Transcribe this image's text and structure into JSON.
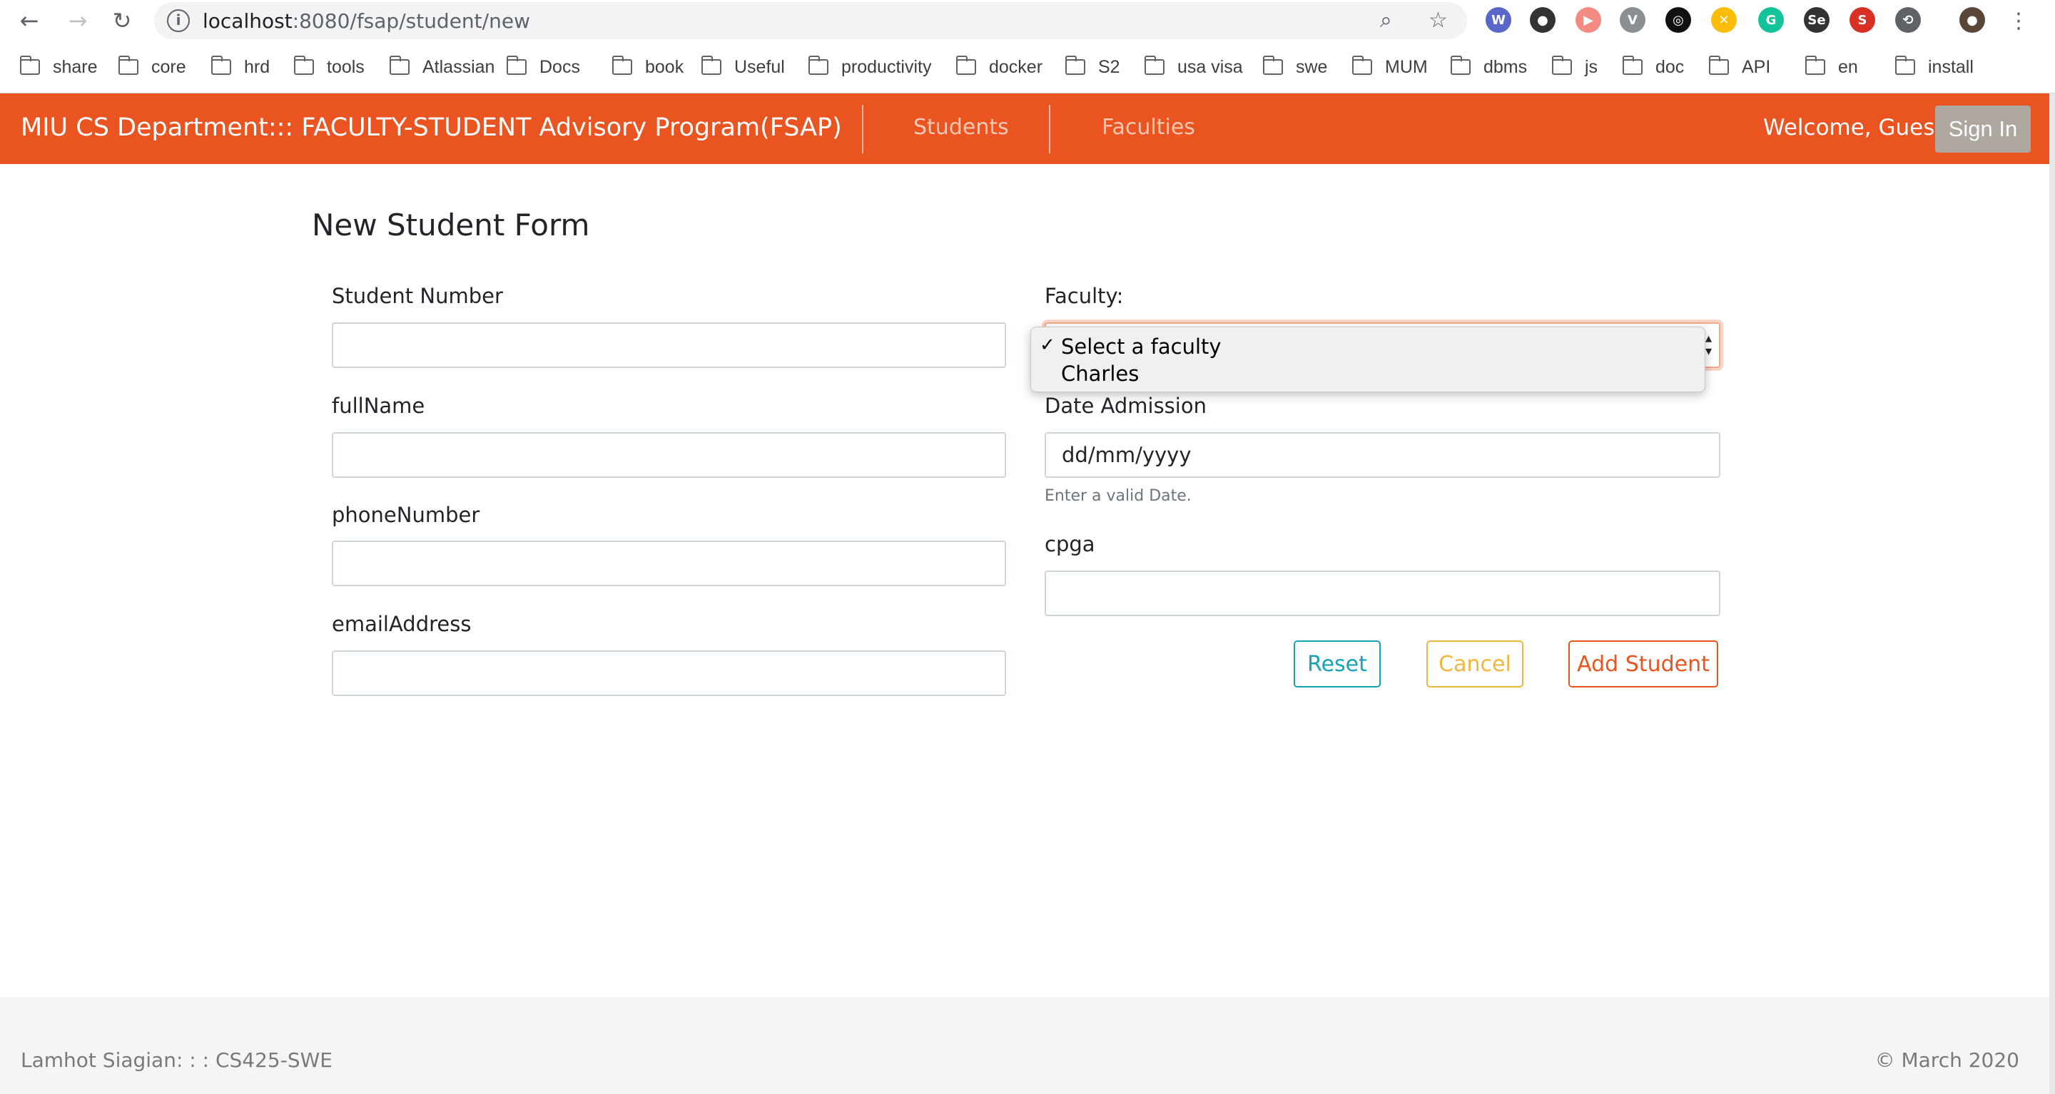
{
  "browser": {
    "url_host": "localhost",
    "url_rest": ":8080/fsap/student/new",
    "bookmarks": [
      "share",
      "core",
      "hrd",
      "tools",
      "Atlassian",
      "Docs",
      "book",
      "Useful",
      "productivity",
      "docker",
      "S2",
      "usa visa",
      "swe",
      "MUM",
      "dbms",
      "js",
      "doc",
      "API",
      "en",
      "install"
    ],
    "extensions": [
      {
        "name": "extension-w-icon",
        "glyph": "W",
        "color": "#5a67c8"
      },
      {
        "name": "extension-mask-icon",
        "glyph": "●",
        "color": "#333333"
      },
      {
        "name": "extension-arrow-icon",
        "glyph": "▶",
        "color": "#f28b82"
      },
      {
        "name": "extension-v-icon",
        "glyph": "V",
        "color": "#8a8f94"
      },
      {
        "name": "extension-target-icon",
        "glyph": "◎",
        "color": "#111111"
      },
      {
        "name": "extension-chrome-icon",
        "glyph": "✕",
        "color": "#fbbc05"
      },
      {
        "name": "extension-grammarly-icon",
        "glyph": "G",
        "color": "#15c39a"
      },
      {
        "name": "extension-selenium-icon",
        "glyph": "Se",
        "color": "#333333"
      },
      {
        "name": "extension-s-icon",
        "glyph": "S",
        "color": "#d93025"
      },
      {
        "name": "extension-history-icon",
        "glyph": "⟲",
        "color": "#5f6368"
      }
    ]
  },
  "navbar": {
    "brand": "MIU CS Department::: FACULTY-STUDENT Advisory Program(FSAP)",
    "links": [
      "Students",
      "Faculties"
    ],
    "welcome": "Welcome, Guest",
    "signin": "Sign In",
    "accent_color": "#e95420"
  },
  "form": {
    "title": "New Student Form",
    "student_number_label": "Student Number",
    "fullname_label": "fullName",
    "phone_label": "phoneNumber",
    "email_label": "emailAddress",
    "faculty_label": "Faculty:",
    "faculty_options": [
      "Select a faculty",
      "Charles"
    ],
    "faculty_selected": "Select a faculty",
    "date_label": "Date Admission",
    "date_placeholder": "dd/mm/yyyy",
    "date_help": "Enter a valid Date.",
    "cpga_label": "cpga",
    "reset_label": "Reset",
    "cancel_label": "Cancel",
    "add_label": "Add Student"
  },
  "footer": {
    "left": "Lamhot Siagian: : : CS425-SWE",
    "right": "© March 2020"
  }
}
